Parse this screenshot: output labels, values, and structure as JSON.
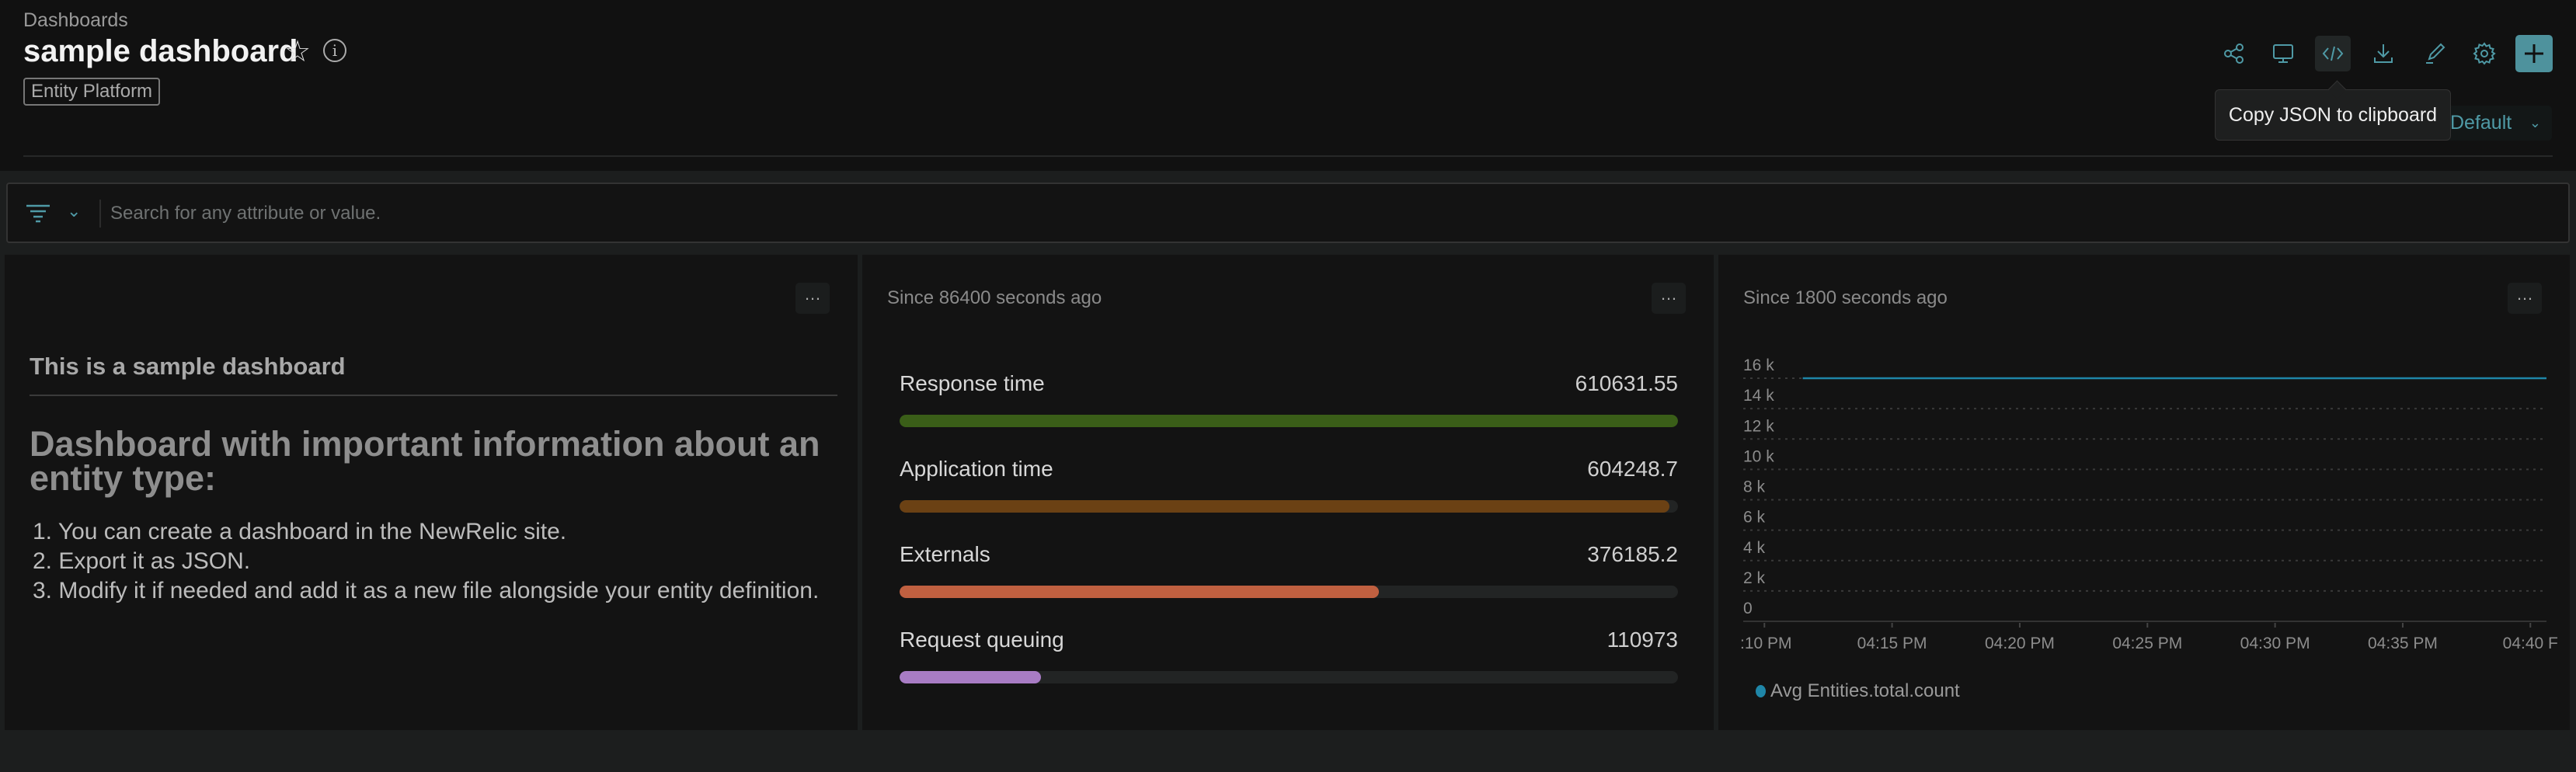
{
  "header": {
    "breadcrumb": "Dashboards",
    "title": "sample dashboard",
    "tag": "Entity Platform"
  },
  "toolbar": {
    "icons": [
      "share-icon",
      "tv-mode-icon",
      "code-icon",
      "download-icon",
      "pencil-icon",
      "gear-icon",
      "plus-icon"
    ],
    "tooltip": "Copy JSON to clipboard",
    "timezone": "Default",
    "accent": "#4e929d"
  },
  "filter": {
    "placeholder": "Search for any attribute or value."
  },
  "panels": {
    "markdown": {
      "heading3": "This is a sample dashboard",
      "heading1": "Dashboard with important information about an entity type:",
      "items": [
        "1. You can create a dashboard in the NewRelic site.",
        "2. Export it as JSON.",
        "3. Modify it if needed and add it as a new file alongside your entity definition."
      ]
    },
    "bars": {
      "since": "Since 86400 seconds ago",
      "rows": [
        {
          "label": "Response time",
          "value": "610631.55",
          "fraction": 1.0,
          "color": "#3a5e18"
        },
        {
          "label": "Application time",
          "value": "604248.7",
          "fraction": 0.9895,
          "color": "#6b4114"
        },
        {
          "label": "Externals",
          "value": "376185.2",
          "fraction": 0.616,
          "color": "#c06040"
        },
        {
          "label": "Request queuing",
          "value": "110973",
          "fraction": 0.1817,
          "color": "#a87cc4"
        }
      ]
    },
    "line": {
      "since": "Since 1800 seconds ago"
    }
  },
  "chart_data": {
    "type": "line",
    "title": "",
    "xlabel": "",
    "ylabel": "",
    "ylim": [
      0,
      16000
    ],
    "yticks": [
      "0",
      "2 k",
      "4 k",
      "6 k",
      "8 k",
      "10 k",
      "12 k",
      "14 k",
      "16 k"
    ],
    "xlim": [
      "04:09 PM",
      "04:40 PM"
    ],
    "xticks": [
      ":10 PM",
      "04:15 PM",
      "04:20 PM",
      "04:25 PM",
      "04:30 PM",
      "04:35 PM",
      "04:40 F"
    ],
    "grid": true,
    "legend": "bottom-left",
    "series": [
      {
        "name": "Avg Entities.total.count",
        "color": "#1f86a8",
        "x": [
          "04:11 PM",
          "04:40 PM"
        ],
        "y": [
          16000,
          16000
        ]
      }
    ]
  }
}
